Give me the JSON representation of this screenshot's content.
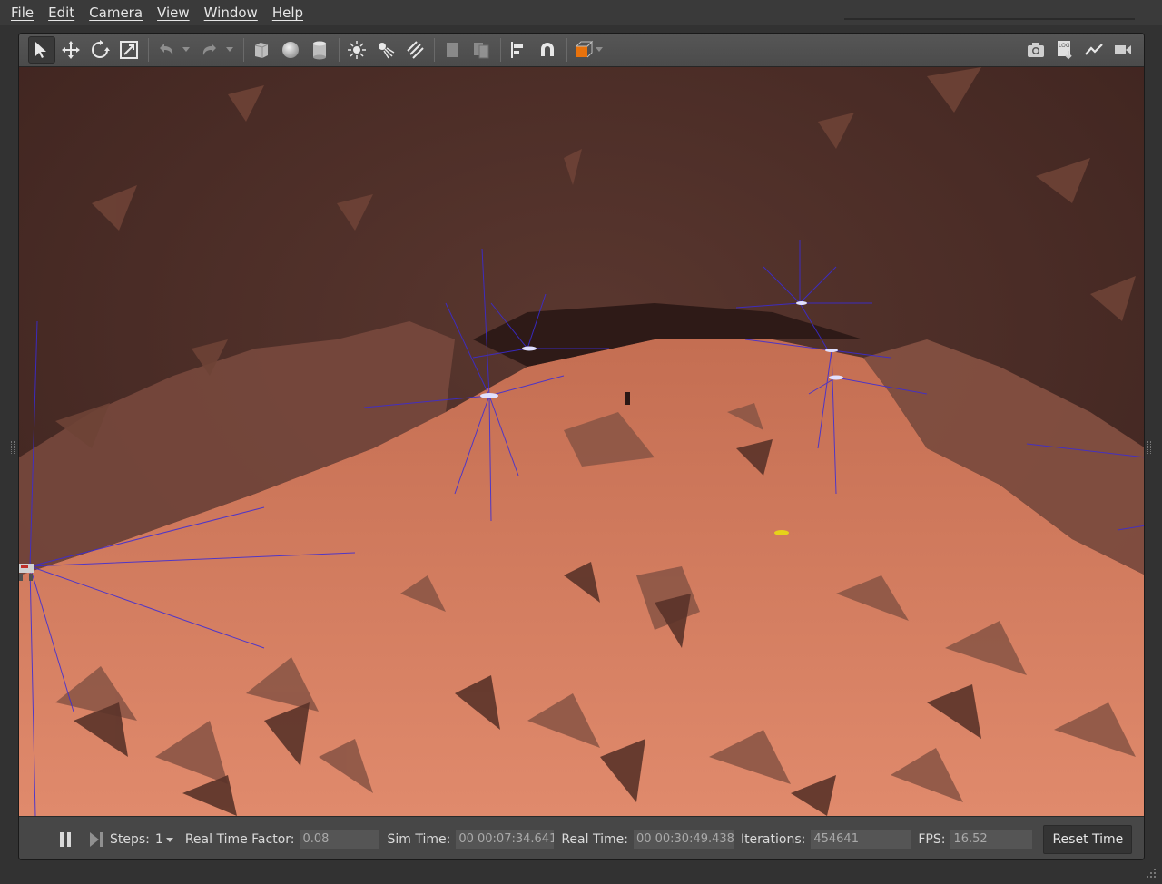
{
  "menubar": {
    "items": [
      {
        "label": "File"
      },
      {
        "label": "Edit"
      },
      {
        "label": "Camera"
      },
      {
        "label": "View"
      },
      {
        "label": "Window"
      },
      {
        "label": "Help"
      }
    ]
  },
  "toolbar": {
    "left_tools": [
      "select-icon",
      "translate-icon",
      "rotate-icon",
      "scale-icon",
      "undo-icon",
      "redo-icon",
      "box-shape-icon",
      "sphere-shape-icon",
      "cylinder-shape-icon",
      "point-light-icon",
      "spot-light-icon",
      "directional-light-icon",
      "copy-icon",
      "paste-icon",
      "align-icon",
      "magnet-icon",
      "view-angle-icon"
    ],
    "right_tools": [
      "screenshot-icon",
      "log-icon",
      "plot-icon",
      "video-record-icon"
    ],
    "log_text": "LOG",
    "accent_color": "#e8720c"
  },
  "viewport": {
    "scene": "3d-cave-simulation",
    "colors": {
      "floor": "#d4785a",
      "wall": "#4a2c26",
      "shadow": "#2e1a17",
      "laser": "#3a2bd8",
      "marker": "#e6d21a"
    }
  },
  "statusbar": {
    "steps_label": "Steps:",
    "steps_value": "1",
    "rtf_label": "Real Time Factor:",
    "rtf_value": "0.08",
    "sim_time_label": "Sim Time:",
    "sim_time_value": "00 00:07:34.641",
    "real_time_label": "Real Time:",
    "real_time_value": "00 00:30:49.438",
    "iterations_label": "Iterations:",
    "iterations_value": "454641",
    "fps_label": "FPS:",
    "fps_value": "16.52",
    "reset_label": "Reset Time"
  }
}
